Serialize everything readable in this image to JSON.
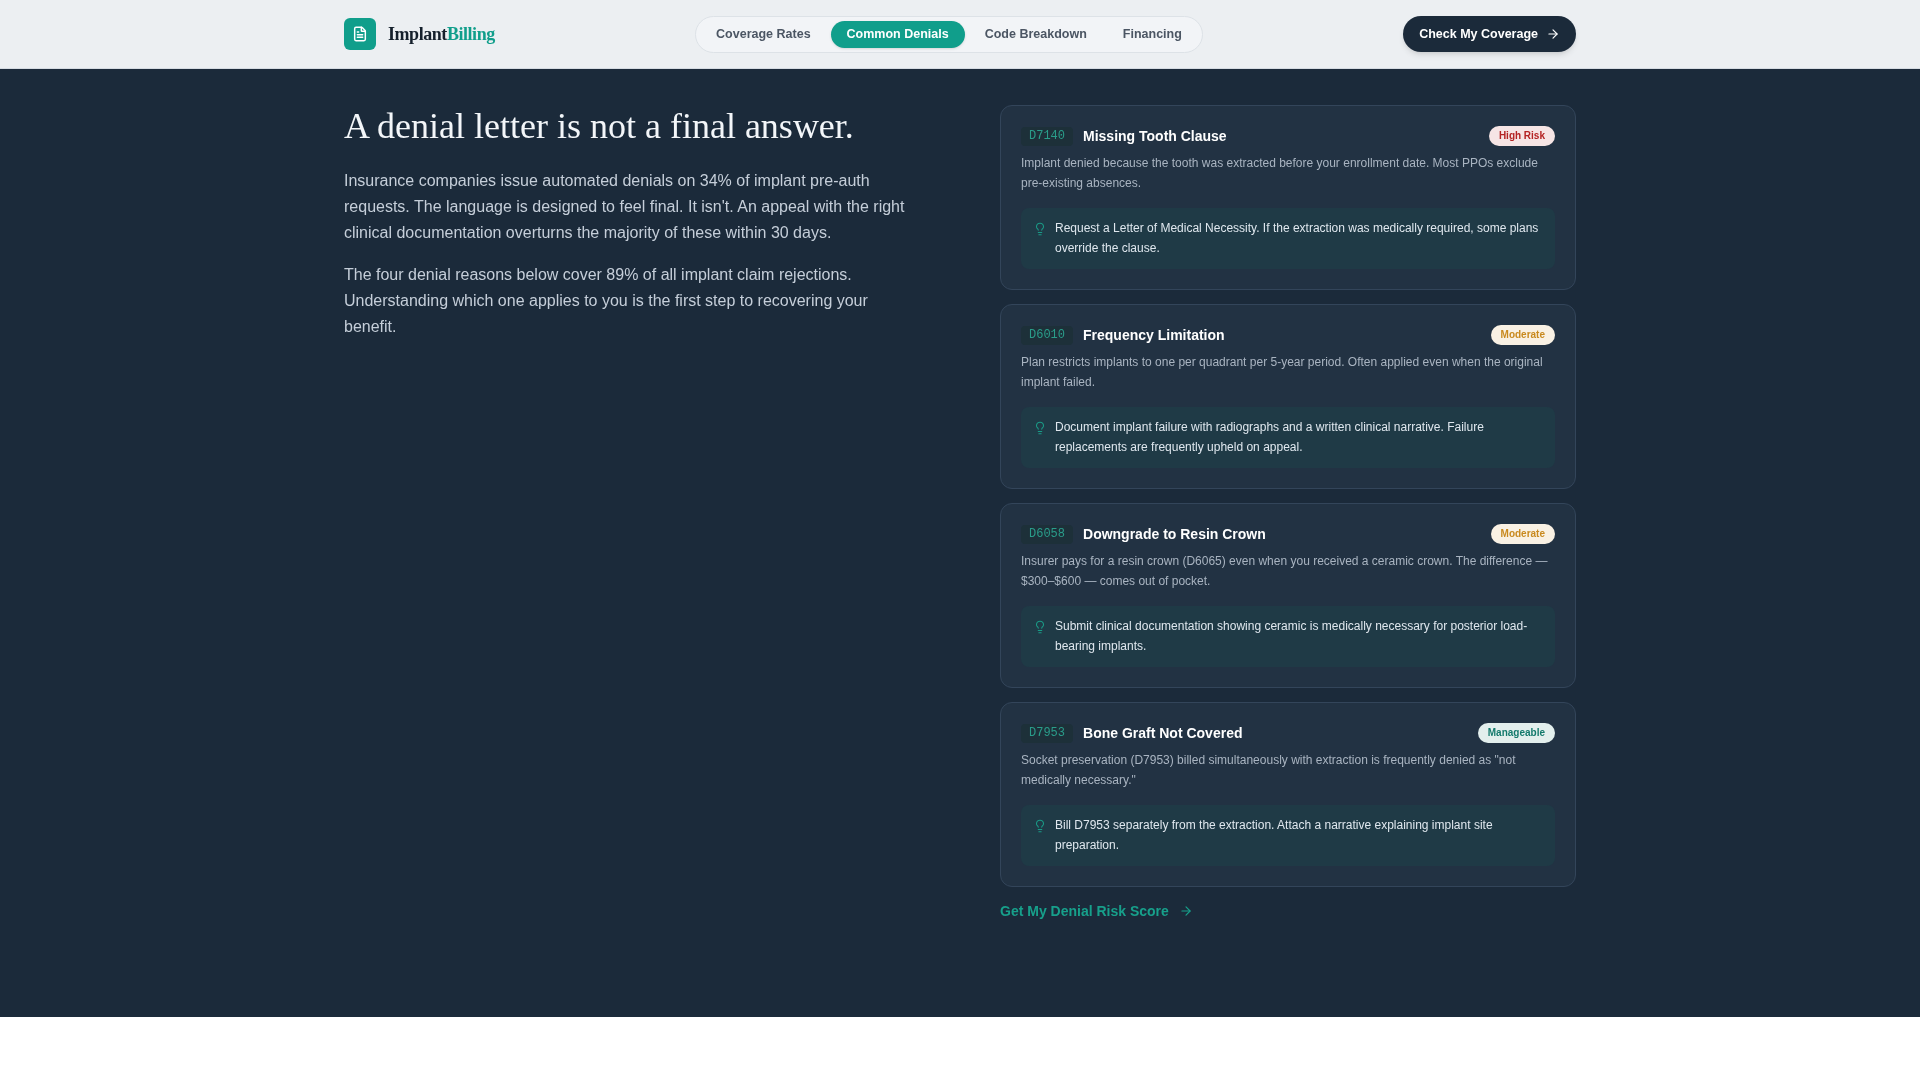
{
  "header": {
    "logo_text": [
      "Implant",
      "Billing"
    ],
    "nav": [
      {
        "label": "Coverage Rates",
        "selected": false
      },
      {
        "label": "Common Denials",
        "selected": true
      },
      {
        "label": "Code Breakdown",
        "selected": false
      },
      {
        "label": "Financing",
        "selected": false
      }
    ],
    "cta": "Check My Coverage"
  },
  "intro": {
    "heading": "A denial letter is not a final answer.",
    "paragraphs": [
      "Insurance companies issue automated denials on 34% of implant pre-auth requests. The language is designed to feel final. It isn't. An appeal with the right clinical documentation overturns the majority of these within 30 days.",
      "The four denial reasons below cover 89% of all implant claim rejections. Understanding which one applies to you is the first step to recovering your benefit."
    ]
  },
  "denials": [
    {
      "code": "D7140",
      "title": "Missing Tooth Clause",
      "risk": "High Risk",
      "color": "#b42323",
      "description": "Implant denied because the tooth was extracted before your enrollment date. Most PPOs exclude pre-existing absences.",
      "tip": "Request a Letter of Medical Necessity. If the extraction was medically required, some plans override the clause."
    },
    {
      "code": "D6010",
      "title": "Frequency Limitation",
      "risk": "Moderate",
      "color": "#c98a1f",
      "description": "Plan restricts implants to one per quadrant per 5-year period. Often applied even when the original implant failed.",
      "tip": "Document implant failure with radiographs and a written clinical narrative. Failure replacements are frequently upheld on appeal."
    },
    {
      "code": "D6058",
      "title": "Downgrade to Resin Crown",
      "risk": "Moderate",
      "color": "#c98a1f",
      "description": "Insurer pays for a resin crown (D6065) even when you received a ceramic crown. The difference — $300–$600 — comes out of pocket.",
      "tip": "Submit clinical documentation showing ceramic is medically necessary for posterior load-bearing implants."
    },
    {
      "code": "D7953",
      "title": "Bone Graft Not Covered",
      "risk": "Manageable",
      "color": "#147a6c",
      "description": "Socket preservation (D7953) billed simultaneously with extraction is frequently denied as \"not medically necessary.\"",
      "tip": "Bill D7953 separately from the extraction. Attach a narrative explaining implant site preparation."
    }
  ],
  "link": "Get My Denial Risk Score"
}
